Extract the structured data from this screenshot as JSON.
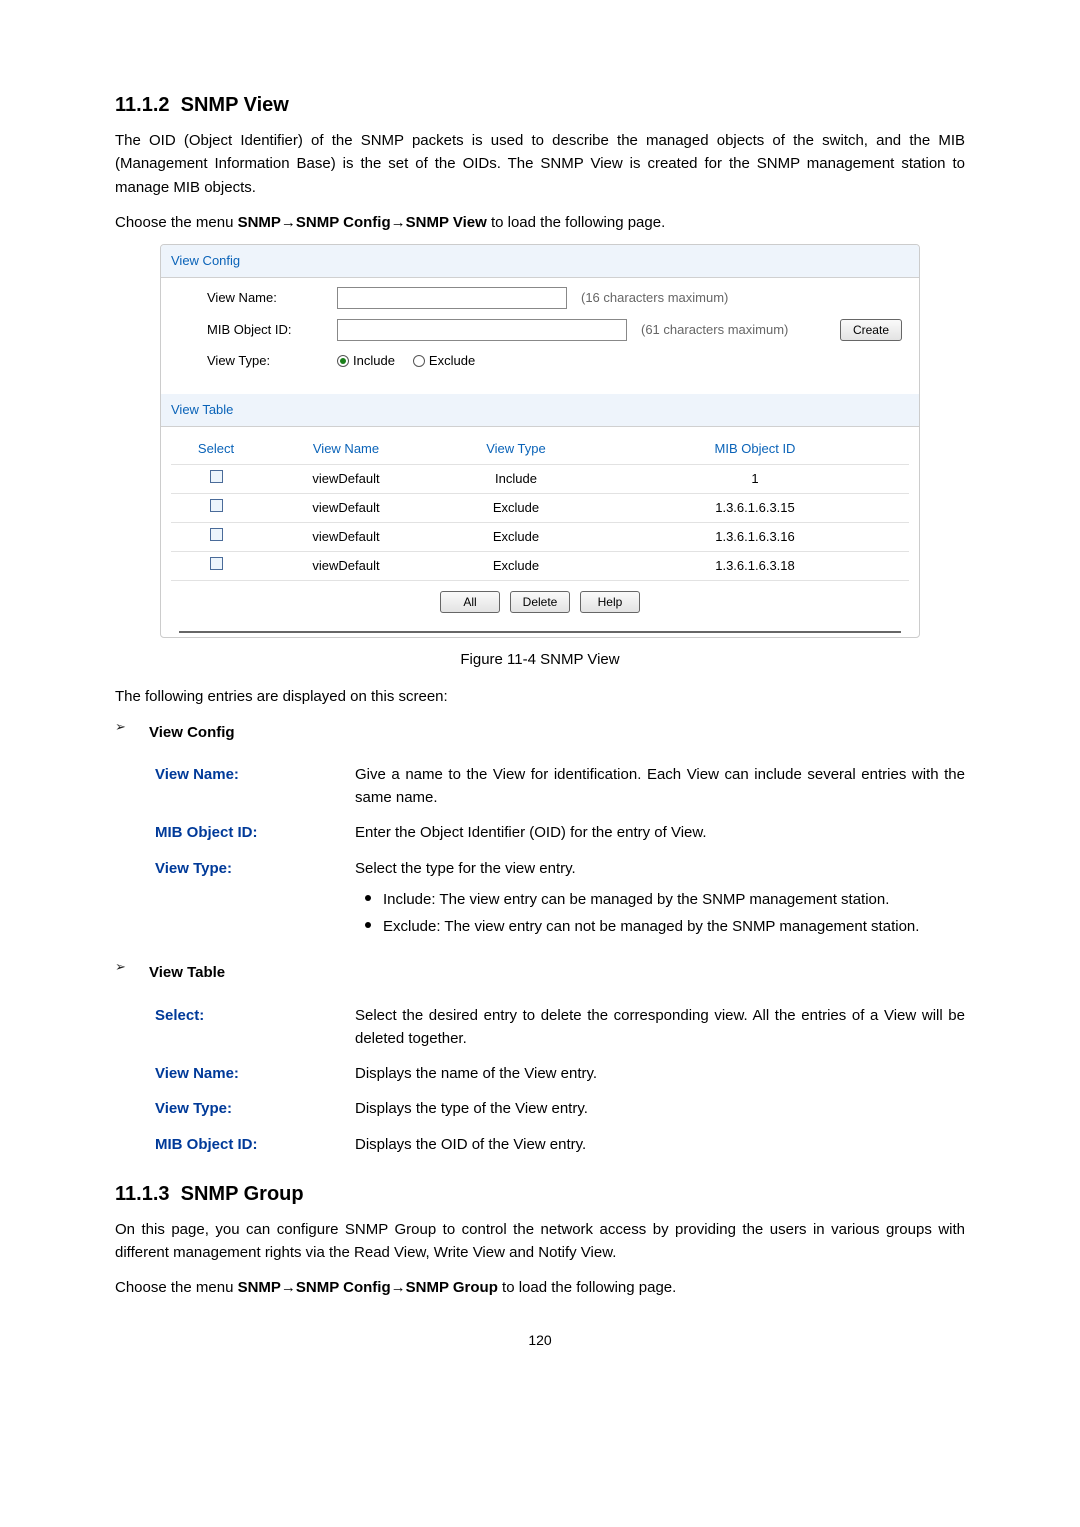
{
  "section_view": {
    "number": "11.1.2",
    "title": "SNMP View",
    "intro": "The OID (Object Identifier) of the SNMP packets is used to describe the managed objects of the switch, and the MIB (Management Information Base) is the set of the OIDs. The SNMP View is created for the SNMP management station to manage MIB objects.",
    "menu_prefix": "Choose the menu ",
    "menu_path": "SNMP→SNMP Config→SNMP View",
    "menu_suffix": " to load the following page."
  },
  "panel": {
    "title_config": "View Config",
    "label_view_name": "View Name:",
    "label_mib": "MIB Object ID:",
    "label_view_type": "View Type:",
    "hint_name": "(16 characters maximum)",
    "hint_mib": "(61 characters maximum)",
    "btn_create": "Create",
    "radio_include": "Include",
    "radio_exclude": "Exclude",
    "title_table": "View Table",
    "columns": {
      "select": "Select",
      "name": "View Name",
      "type": "View Type",
      "mib": "MIB Object ID"
    },
    "rows": [
      {
        "name": "viewDefault",
        "type": "Include",
        "mib": "1"
      },
      {
        "name": "viewDefault",
        "type": "Exclude",
        "mib": "1.3.6.1.6.3.15"
      },
      {
        "name": "viewDefault",
        "type": "Exclude",
        "mib": "1.3.6.1.6.3.16"
      },
      {
        "name": "viewDefault",
        "type": "Exclude",
        "mib": "1.3.6.1.6.3.18"
      }
    ],
    "btn_all": "All",
    "btn_delete": "Delete",
    "btn_help": "Help"
  },
  "figure_caption": "Figure 11-4 SNMP View",
  "entries_intro": "The following entries are displayed on this screen:",
  "vc": {
    "heading": "View Config",
    "items": {
      "view_name_t": "View Name:",
      "view_name_d": "Give a name to the View for identification. Each View can include several entries with the same name.",
      "mib_t": "MIB Object ID:",
      "mib_d": "Enter the Object Identifier (OID) for the entry of View.",
      "view_type_t": "View Type:",
      "view_type_d": "Select the type for the view entry.",
      "include_d": "Include: The view entry can be managed by the SNMP management station.",
      "exclude_d": "Exclude: The view entry can not be managed by the SNMP management station."
    }
  },
  "vt": {
    "heading": "View Table",
    "items": {
      "select_t": "Select:",
      "select_d": "Select the desired entry to delete the corresponding view. All the entries of a View will be deleted together.",
      "name_t": "View Name:",
      "name_d": "Displays the name of the View entry.",
      "type_t": "View Type:",
      "type_d": "Displays the type of the View entry.",
      "mib_t": "MIB Object ID:",
      "mib_d": "Displays the OID of the View entry."
    }
  },
  "section_group": {
    "number": "11.1.3",
    "title": "SNMP Group",
    "intro": "On this page, you can configure SNMP Group to control the network access by providing the users in various groups with different management rights via the Read View, Write View and Notify View.",
    "menu_prefix": "Choose the menu ",
    "menu_path": "SNMP→SNMP Config→SNMP Group",
    "menu_suffix": " to load the following page."
  },
  "page_number": "120"
}
